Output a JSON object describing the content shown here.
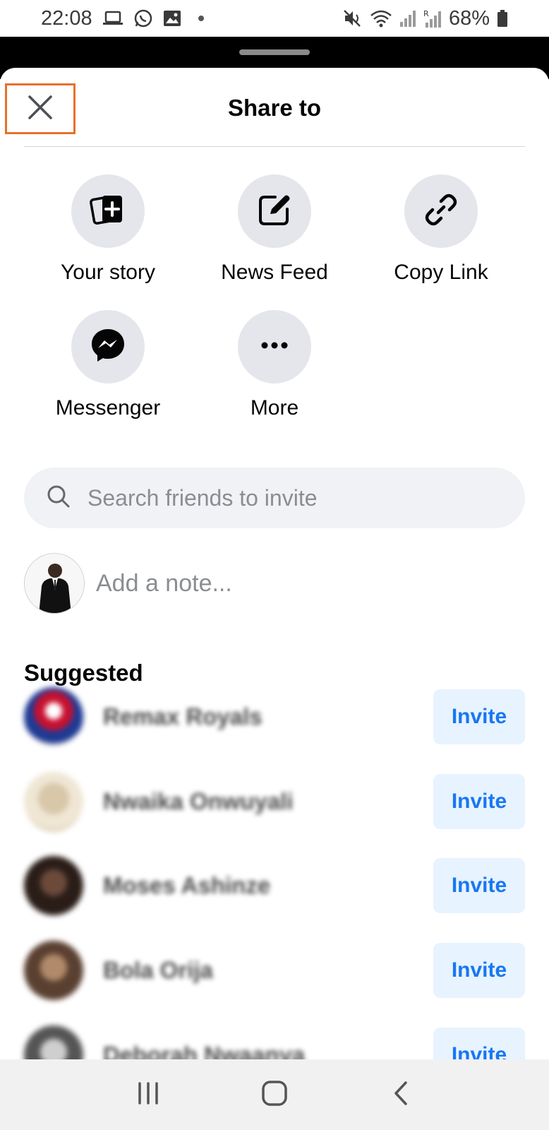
{
  "status_bar": {
    "time": "22:08",
    "left_icons": [
      "laptop-icon",
      "whatsapp-icon",
      "gallery-icon"
    ],
    "right_icons": [
      "mute-icon",
      "wifi-icon",
      "signal-icon",
      "signal-roaming-icon"
    ],
    "battery": "68%"
  },
  "sheet": {
    "title": "Share to",
    "close_icon": "close-icon"
  },
  "share_options": [
    {
      "label": "Your story",
      "icon": "story-add-icon"
    },
    {
      "label": "News Feed",
      "icon": "edit-icon"
    },
    {
      "label": "Copy Link",
      "icon": "link-icon"
    },
    {
      "label": "Messenger",
      "icon": "messenger-icon"
    },
    {
      "label": "More",
      "icon": "more-icon"
    }
  ],
  "search": {
    "placeholder": "Search friends to invite"
  },
  "note": {
    "placeholder": "Add a note..."
  },
  "suggested": {
    "title": "Suggested",
    "friends": [
      {
        "name": "Remax Royals",
        "action": "Invite"
      },
      {
        "name": "Nwaika Onwuyali",
        "action": "Invite"
      },
      {
        "name": "Moses Ashinze",
        "action": "Invite"
      },
      {
        "name": "Bola Orija",
        "action": "Invite"
      },
      {
        "name": "Deborah Nwaanya",
        "action": "Invite"
      }
    ]
  },
  "colors": {
    "accent": "#1877f2",
    "invite_bg": "#e7f3ff",
    "circle_bg": "#e4e6eb",
    "highlight_border": "#e8702a"
  }
}
